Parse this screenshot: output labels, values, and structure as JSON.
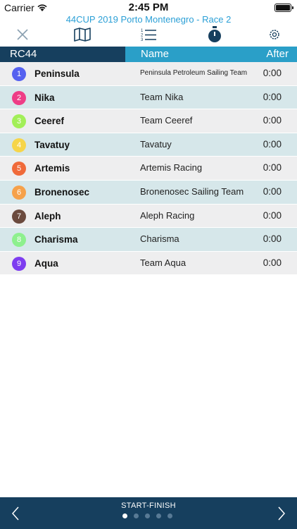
{
  "status": {
    "carrier": "Carrier",
    "time": "2:45 PM"
  },
  "header": {
    "race_title": "44CUP 2019 Porto Montenegro - Race 2"
  },
  "toolbar": {
    "icons": [
      "close-icon",
      "map-icon",
      "ranked-list-icon",
      "stopwatch-icon",
      "gear-icon"
    ],
    "active": "stopwatch-icon",
    "accent": "#163f5e",
    "inactive": "#8aa0b0"
  },
  "table": {
    "col_class": "RC44",
    "col_name": "Name",
    "col_after": "After",
    "rows": [
      {
        "num": "1",
        "boat": "Peninsula",
        "team": "Peninsula Petroleum Sailing Team",
        "after": "0:00",
        "color": "#5561f0"
      },
      {
        "num": "2",
        "boat": "Nika",
        "team": "Team Nika",
        "after": "0:00",
        "color": "#ee3d86"
      },
      {
        "num": "3",
        "boat": "Ceeref",
        "team": "Team Ceeref",
        "after": "0:00",
        "color": "#a2ef58"
      },
      {
        "num": "4",
        "boat": "Tavatuy",
        "team": "Tavatuy",
        "after": "0:00",
        "color": "#f6d54a"
      },
      {
        "num": "5",
        "boat": "Artemis",
        "team": "Artemis Racing",
        "after": "0:00",
        "color": "#f06a3a"
      },
      {
        "num": "6",
        "boat": "Bronenosec",
        "team": "Bronenosec Sailing Team",
        "after": "0:00",
        "color": "#f6a14a"
      },
      {
        "num": "7",
        "boat": "Aleph",
        "team": "Aleph Racing",
        "after": "0:00",
        "color": "#6b4a3e"
      },
      {
        "num": "8",
        "boat": "Charisma",
        "team": "Charisma",
        "after": "0:00",
        "color": "#8ef08e"
      },
      {
        "num": "9",
        "boat": "Aqua",
        "team": "Team Aqua",
        "after": "0:00",
        "color": "#7e3df0"
      }
    ]
  },
  "footer": {
    "label": "START-FINISH",
    "page_count": 5,
    "active_page": 1
  }
}
